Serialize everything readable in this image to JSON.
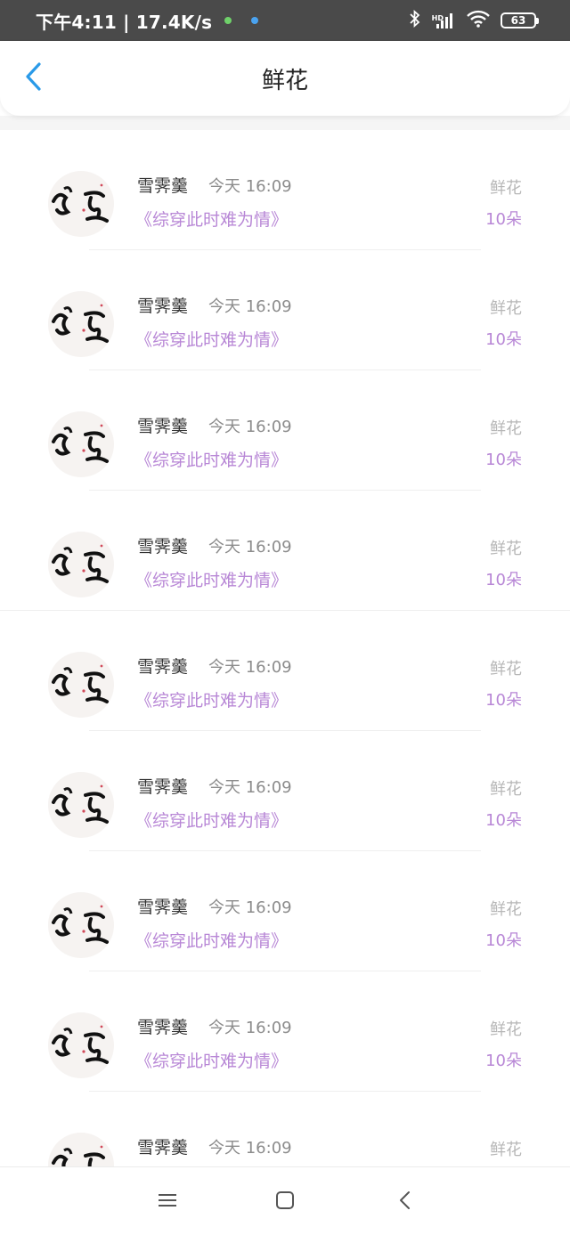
{
  "status": {
    "time_speed": "下午4:11 | 17.4K/s",
    "battery": "63",
    "hd": "HD"
  },
  "header": {
    "title": "鲜花"
  },
  "rows": [
    {
      "name": "雪霁羹",
      "time": "今天 16:09",
      "book": "《综穿此时难为情》",
      "gift_type": "鲜花",
      "gift_count": "10朵"
    },
    {
      "name": "雪霁羹",
      "time": "今天 16:09",
      "book": "《综穿此时难为情》",
      "gift_type": "鲜花",
      "gift_count": "10朵"
    },
    {
      "name": "雪霁羹",
      "time": "今天 16:09",
      "book": "《综穿此时难为情》",
      "gift_type": "鲜花",
      "gift_count": "10朵"
    },
    {
      "name": "雪霁羹",
      "time": "今天 16:09",
      "book": "《综穿此时难为情》",
      "gift_type": "鲜花",
      "gift_count": "10朵"
    },
    {
      "name": "雪霁羹",
      "time": "今天 16:09",
      "book": "《综穿此时难为情》",
      "gift_type": "鲜花",
      "gift_count": "10朵"
    },
    {
      "name": "雪霁羹",
      "time": "今天 16:09",
      "book": "《综穿此时难为情》",
      "gift_type": "鲜花",
      "gift_count": "10朵"
    },
    {
      "name": "雪霁羹",
      "time": "今天 16:09",
      "book": "《综穿此时难为情》",
      "gift_type": "鲜花",
      "gift_count": "10朵"
    },
    {
      "name": "雪霁羹",
      "time": "今天 16:09",
      "book": "《综穿此时难为情》",
      "gift_type": "鲜花",
      "gift_count": "10朵"
    },
    {
      "name": "雪霁羹",
      "time": "今天 16:09",
      "book": "",
      "gift_type": "鲜花",
      "gift_count": ""
    }
  ],
  "colors": {
    "accent_blue": "#2a9ae8",
    "book_purple": "#b887d6",
    "status_bar": "#4a4a4a"
  },
  "icons": {
    "back": "chevron-left-icon",
    "menu": "menu-icon",
    "home": "home-square-icon",
    "system_back": "system-back-icon"
  }
}
